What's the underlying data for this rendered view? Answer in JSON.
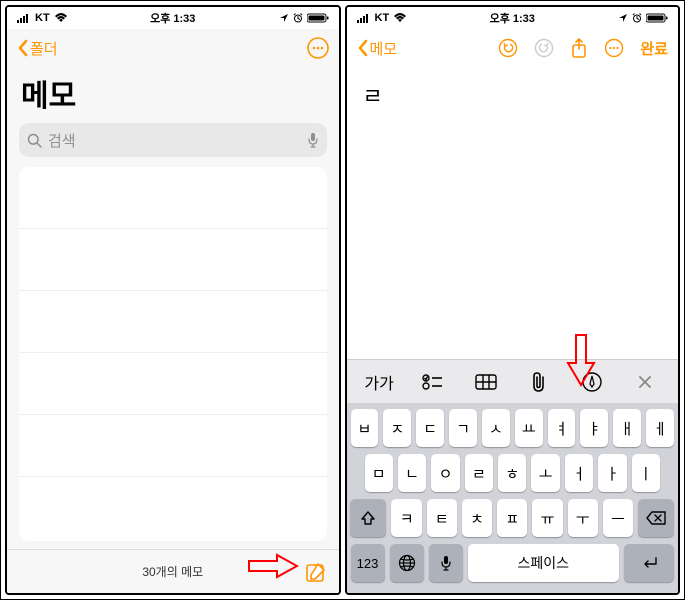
{
  "status": {
    "carrier": "KT",
    "time": "오후 1:33"
  },
  "left": {
    "back_label": "폴더",
    "title": "메모",
    "search_placeholder": "검색",
    "footer_count": "30개의 메모"
  },
  "right": {
    "back_label": "메모",
    "done_label": "완료",
    "note_text": "ㄹ",
    "format_bar": {
      "text_btn": "가가",
      "space_label": "스페이스",
      "num_label": "123"
    },
    "keyboard": {
      "row1": [
        "ㅂ",
        "ㅈ",
        "ㄷ",
        "ㄱ",
        "ㅅ",
        "ㅛ",
        "ㅕ",
        "ㅑ",
        "ㅐ",
        "ㅔ"
      ],
      "row2": [
        "ㅁ",
        "ㄴ",
        "ㅇ",
        "ㄹ",
        "ㅎ",
        "ㅗ",
        "ㅓ",
        "ㅏ",
        "ㅣ"
      ],
      "row3": [
        "ㅋ",
        "ㅌ",
        "ㅊ",
        "ㅍ",
        "ㅠ",
        "ㅜ",
        "ㅡ"
      ]
    }
  }
}
